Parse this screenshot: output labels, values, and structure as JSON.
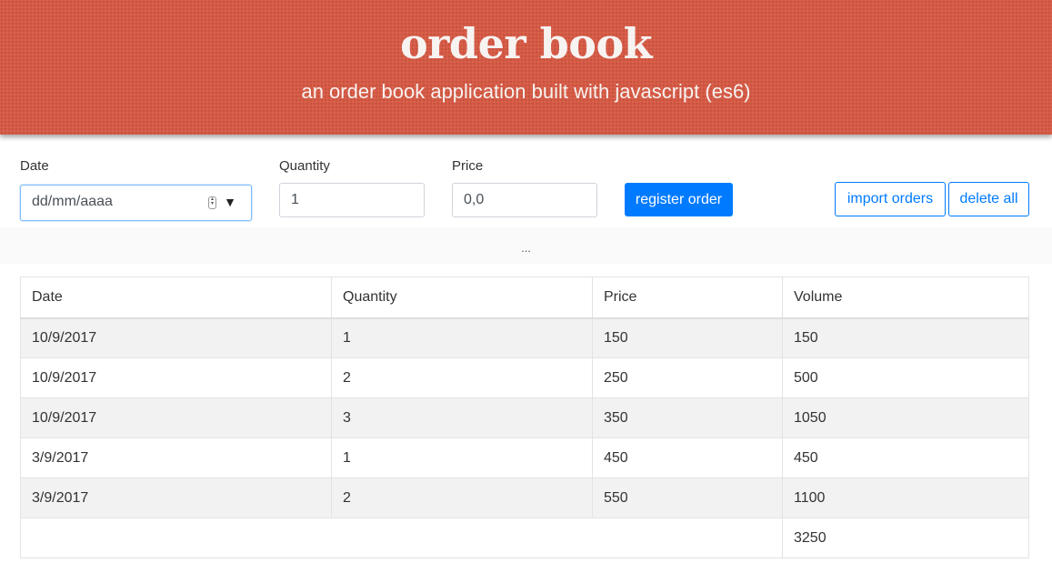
{
  "header": {
    "title": "order book",
    "subtitle": "an order book application built with javascript (es6)"
  },
  "form": {
    "date_label": "Date",
    "date_placeholder": "dd/mm/aaaa",
    "quantity_label": "Quantity",
    "quantity_value": "1",
    "price_label": "Price",
    "price_value": "0,0",
    "register_label": "register order",
    "import_label": "import orders",
    "delete_label": "delete all"
  },
  "message": "...",
  "table": {
    "headers": [
      "Date",
      "Quantity",
      "Price",
      "Volume"
    ],
    "rows": [
      [
        "10/9/2017",
        "1",
        "150",
        "150"
      ],
      [
        "10/9/2017",
        "2",
        "250",
        "500"
      ],
      [
        "10/9/2017",
        "3",
        "350",
        "1050"
      ],
      [
        "3/9/2017",
        "1",
        "450",
        "450"
      ],
      [
        "3/9/2017",
        "2",
        "550",
        "1100"
      ]
    ],
    "total": "3250"
  },
  "colors": {
    "header_bg": "#d65a45",
    "primary": "#007bff"
  }
}
